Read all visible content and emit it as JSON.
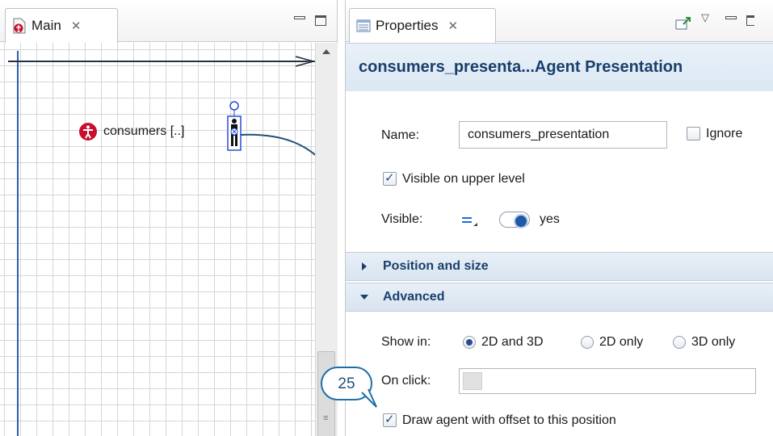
{
  "left_pane": {
    "tab_label": "Main",
    "canvas": {
      "agent_label": "consumers [..]"
    }
  },
  "right_pane": {
    "tab_label": "Properties",
    "header_title": "consumers_presenta...Agent Presentation",
    "name_label": "Name:",
    "name_value": "consumers_presentation",
    "ignore_label": "Ignore",
    "ignore_checked": false,
    "visible_upper_label": "Visible on upper level",
    "visible_upper_checked": true,
    "visible_label": "Visible:",
    "visible_value": "yes",
    "sections": {
      "position_size": "Position and size",
      "advanced": "Advanced"
    },
    "show_in_label": "Show in:",
    "show_in_options": [
      "2D and 3D",
      "2D only",
      "3D only"
    ],
    "show_in_selected": "2D and 3D",
    "on_click_label": "On click:",
    "on_click_value": "",
    "draw_offset_label": "Draw agent with offset to this position",
    "draw_offset_checked": true
  },
  "callout": {
    "number": "25"
  },
  "colors": {
    "accent_blue": "#1e5aa8",
    "title_text": "#1a3f6b",
    "agent_icon_red": "#c8102e",
    "axis_blue": "#2b5ea8",
    "callout_border": "#1e6fa8"
  },
  "icons": [
    "main-document-icon",
    "properties-icon",
    "tab-close-icon",
    "minimize-icon",
    "maximize-icon",
    "pin-view-icon",
    "view-menu-icon",
    "agent-person-icon",
    "scroll-up-icon"
  ]
}
